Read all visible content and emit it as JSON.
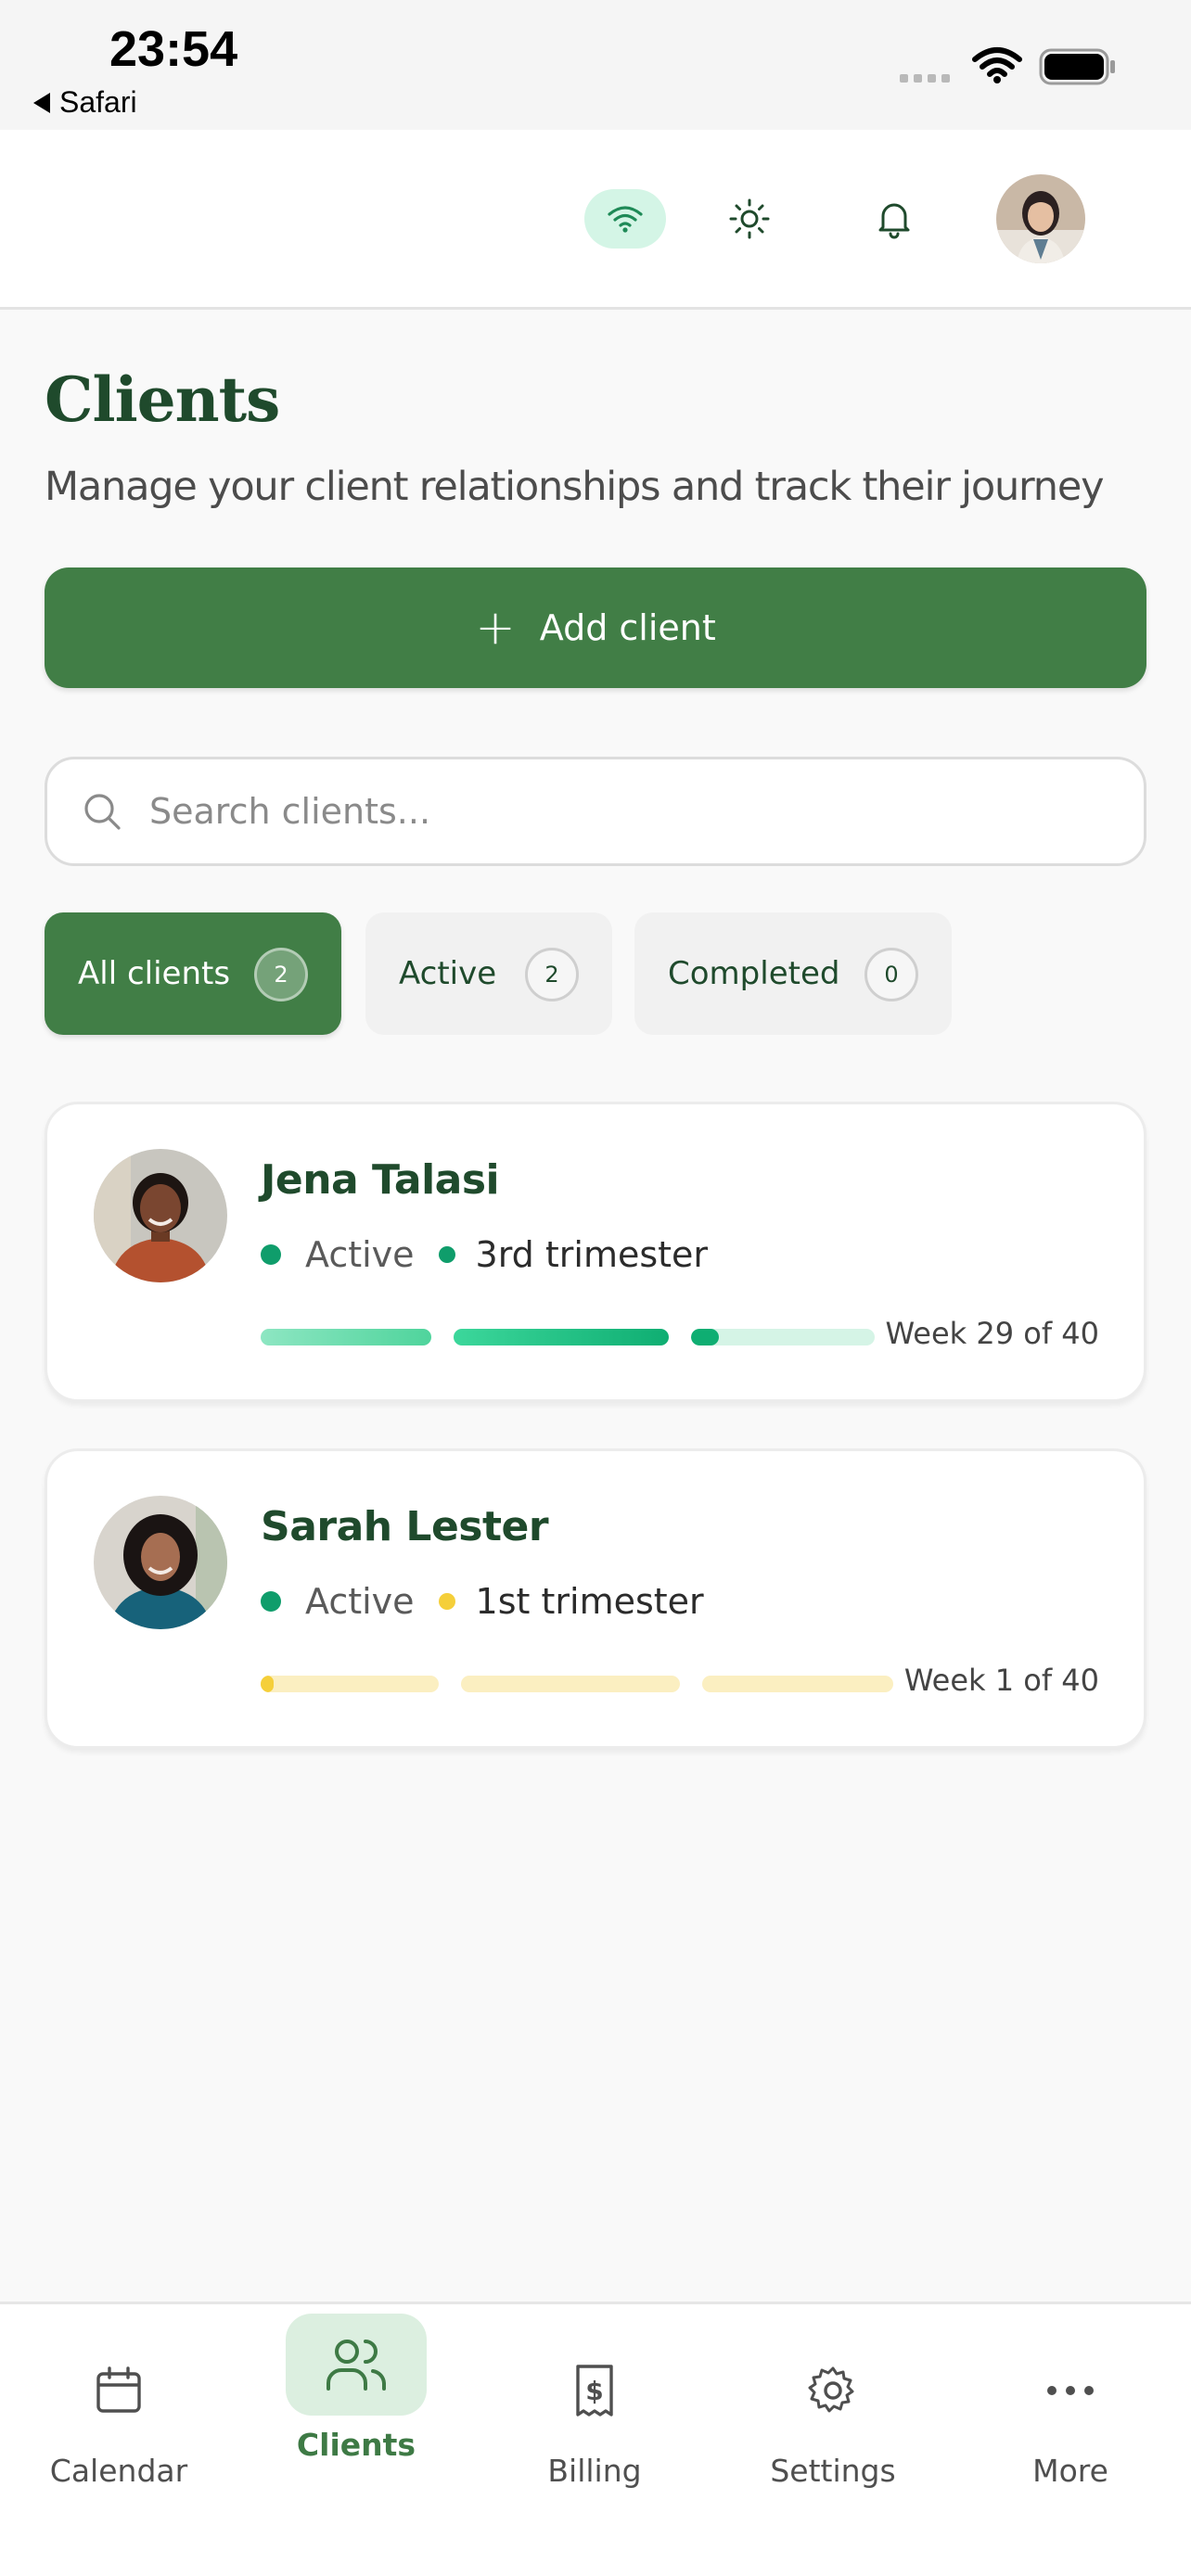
{
  "status_bar": {
    "time": "23:54",
    "back_label": "Safari"
  },
  "header": {
    "icons": [
      "wifi-icon",
      "sun-icon",
      "bell-icon",
      "avatar"
    ]
  },
  "page": {
    "title": "Clients",
    "subtitle": "Manage your client relationships and track their journey",
    "add_button_label": "Add client",
    "search_placeholder": "Search clients..."
  },
  "filters": [
    {
      "label": "All clients",
      "count": "2",
      "selected": true
    },
    {
      "label": "Active",
      "count": "2",
      "selected": false
    },
    {
      "label": "Completed",
      "count": "0",
      "selected": false
    }
  ],
  "clients": [
    {
      "name": "Jena Talasi",
      "status": "Active",
      "status_color": "#0f9d6b",
      "trimester": "3rd trimester",
      "trimester_color": "#0f9d6b",
      "week_text": "Week 29 of 40",
      "trimester_progress": [
        1.0,
        1.0,
        0.15
      ]
    },
    {
      "name": "Sarah Lester",
      "status": "Active",
      "status_color": "#0f9d6b",
      "trimester": "1st trimester",
      "trimester_color": "#f5cf3a",
      "week_text": "Week 1 of 40",
      "trimester_progress": [
        0.07,
        0.0,
        0.0
      ]
    }
  ],
  "bottom_nav": [
    {
      "label": "Calendar",
      "icon": "calendar-icon",
      "selected": false
    },
    {
      "label": "Clients",
      "icon": "users-icon",
      "selected": true
    },
    {
      "label": "Billing",
      "icon": "receipt-dollar-icon",
      "selected": false
    },
    {
      "label": "Settings",
      "icon": "gear-icon",
      "selected": false
    },
    {
      "label": "More",
      "icon": "more-dots-icon",
      "selected": false
    }
  ],
  "colors": {
    "primary": "#417e46",
    "title": "#1f4a2c",
    "accent_green": "#0f9d6b",
    "accent_yellow": "#f5cf3a"
  }
}
